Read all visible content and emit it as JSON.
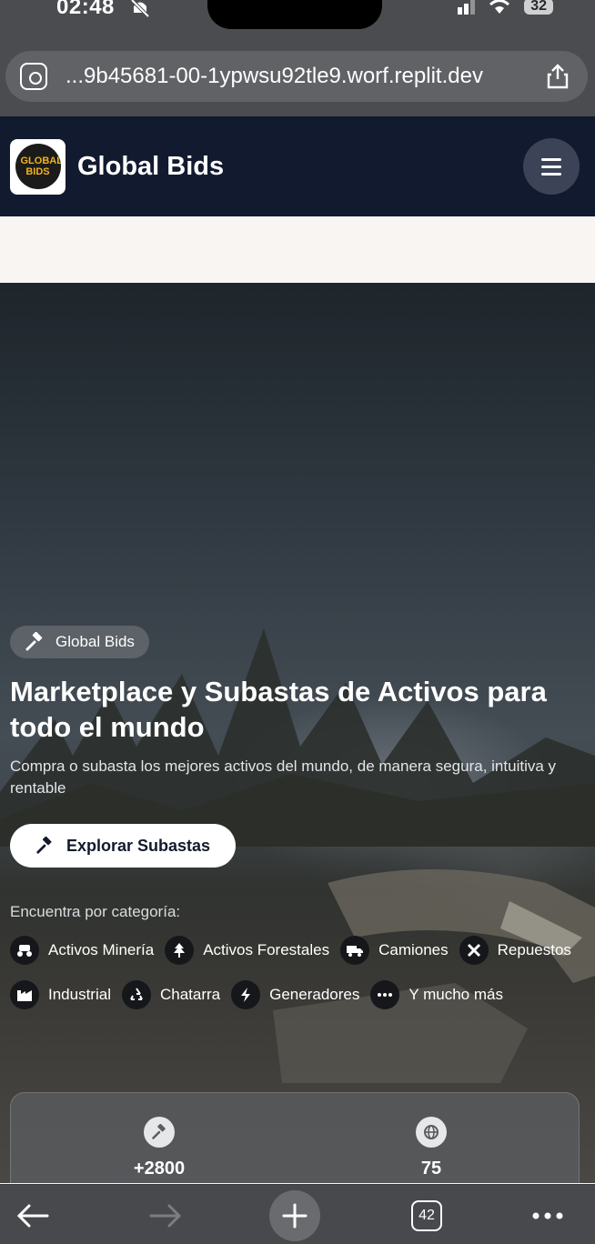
{
  "status_bar": {
    "time": "02:48",
    "battery": "32"
  },
  "browser": {
    "url": "...9b45681-00-1ypwsu92tle9.worf.replit.dev",
    "tab_count": "42"
  },
  "navbar": {
    "brand": "Global Bids",
    "logo_text_line1": "GLOBAL",
    "logo_text_line2": "BIDS"
  },
  "hero": {
    "badge": "Global Bids",
    "title": "Marketplace y Subastas de Activos para todo el mundo",
    "subtitle": "Compra o subasta los mejores activos del mundo, de manera segura, intuitiva y rentable",
    "cta": "Explorar Subastas",
    "categories_title": "Encuentra por categoría:",
    "categories": [
      {
        "label": "Activos Minería",
        "icon": "mining-vehicle-icon"
      },
      {
        "label": "Activos Forestales",
        "icon": "tree-icon"
      },
      {
        "label": "Camiones",
        "icon": "truck-icon"
      },
      {
        "label": "Repuestos",
        "icon": "tools-icon"
      },
      {
        "label": "Industrial",
        "icon": "industry-icon"
      },
      {
        "label": "Chatarra",
        "icon": "recycle-icon"
      },
      {
        "label": "Generadores",
        "icon": "bolt-icon"
      },
      {
        "label": "Y mucho más",
        "icon": "ellipsis-icon"
      }
    ]
  },
  "stats": [
    {
      "value": "+2800",
      "icon": "gavel-icon"
    },
    {
      "value": "75",
      "icon": "globe-icon"
    }
  ],
  "colors": {
    "navbar": "#111a2f",
    "browser_chrome": "#4a4c4f"
  }
}
